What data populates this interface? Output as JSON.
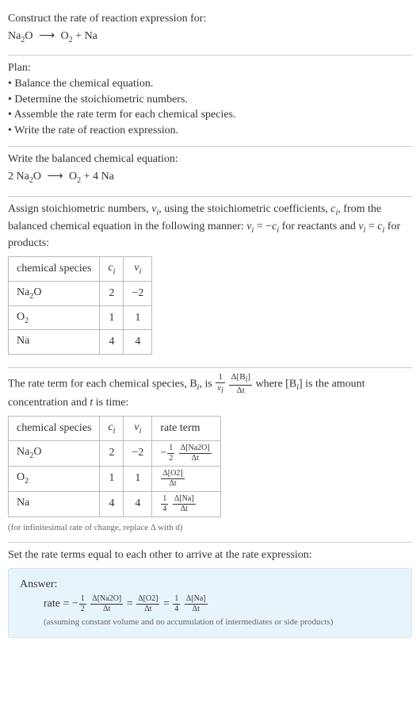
{
  "prompt": {
    "title": "Construct the rate of reaction expression for:",
    "equation_lhs": "Na",
    "equation_lhs_sub": "2",
    "equation_lhs2": "O",
    "arrow": "⟶",
    "equation_rhs1": "O",
    "equation_rhs1_sub": "2",
    "plus": " + ",
    "equation_rhs2": "Na"
  },
  "plan": {
    "heading": "Plan:",
    "b1": "• Balance the chemical equation.",
    "b2": "• Determine the stoichiometric numbers.",
    "b3": "• Assemble the rate term for each chemical species.",
    "b4": "• Write the rate of reaction expression."
  },
  "balanced": {
    "heading": "Write the balanced chemical equation:",
    "c1": "2 Na",
    "c1s": "2",
    "c1b": "O",
    "arrow": "⟶",
    "c2": "O",
    "c2s": "2",
    "plus": " + ",
    "c3": "4 Na"
  },
  "assign": {
    "text_a": "Assign stoichiometric numbers, ",
    "nu_i": "ν",
    "nu_i_sub": "i",
    "text_b": ", using the stoichiometric coefficients, ",
    "c_i": "c",
    "c_i_sub": "i",
    "text_c": ", from the balanced chemical equation in the following manner: ",
    "eq1_l": "ν",
    "eq1_ls": "i",
    "eq1_mid": " = −",
    "eq1_r": "c",
    "eq1_rs": "i",
    "text_d": " for reactants and ",
    "eq2_l": "ν",
    "eq2_ls": "i",
    "eq2_mid": " = ",
    "eq2_r": "c",
    "eq2_rs": "i",
    "text_e": " for products:"
  },
  "table1": {
    "h1": "chemical species",
    "h2": "c",
    "h2s": "i",
    "h3": "ν",
    "h3s": "i",
    "r1": {
      "sp_a": "Na",
      "sp_as": "2",
      "sp_b": "O",
      "c": "2",
      "nu": "−2"
    },
    "r2": {
      "sp_a": "O",
      "sp_as": "2",
      "sp_b": "",
      "c": "1",
      "nu": "1"
    },
    "r3": {
      "sp_a": "Na",
      "sp_as": "",
      "sp_b": "",
      "c": "4",
      "nu": "4"
    }
  },
  "rateterm": {
    "text_a": "The rate term for each chemical species, B",
    "sub_i": "i",
    "text_b": ", is ",
    "one": "1",
    "nu": "ν",
    "nu_s": "i",
    "dBi_top_a": "Δ[B",
    "dBi_top_b": "]",
    "dt": "Δt",
    "text_c": " where [B",
    "text_d": "] is the amount concentration and ",
    "t": "t",
    "text_e": " is time:"
  },
  "table2": {
    "h1": "chemical species",
    "h2": "c",
    "h2s": "i",
    "h3": "ν",
    "h3s": "i",
    "h4": "rate term",
    "r1": {
      "sp_a": "Na",
      "sp_as": "2",
      "sp_b": "O",
      "c": "2",
      "nu": "−2",
      "coef_num": "1",
      "coef_den": "2",
      "neg": "−",
      "top": "Δ[Na2O]",
      "bot": "Δt"
    },
    "r2": {
      "sp_a": "O",
      "sp_as": "2",
      "sp_b": "",
      "c": "1",
      "nu": "1",
      "coef_num": "",
      "coef_den": "",
      "neg": "",
      "top": "Δ[O2]",
      "bot": "Δt"
    },
    "r3": {
      "sp_a": "Na",
      "sp_as": "",
      "sp_b": "",
      "c": "4",
      "nu": "4",
      "coef_num": "1",
      "coef_den": "4",
      "neg": "",
      "top": "Δ[Na]",
      "bot": "Δt"
    }
  },
  "footnote": "(for infinitesimal rate of change, replace Δ with d)",
  "final_heading": "Set the rate terms equal to each other to arrive at the rate expression:",
  "answer": {
    "label": "Answer:",
    "rate": "rate = ",
    "neg": "−",
    "f1_num": "1",
    "f1_den": "2",
    "t1_top": "Δ[Na2O]",
    "t1_bot": "Δt",
    "eq": " = ",
    "t2_top": "Δ[O2]",
    "t2_bot": "Δt",
    "f3_num": "1",
    "f3_den": "4",
    "t3_top": "Δ[Na]",
    "t3_bot": "Δt",
    "note": "(assuming constant volume and no accumulation of intermediates or side products)"
  }
}
